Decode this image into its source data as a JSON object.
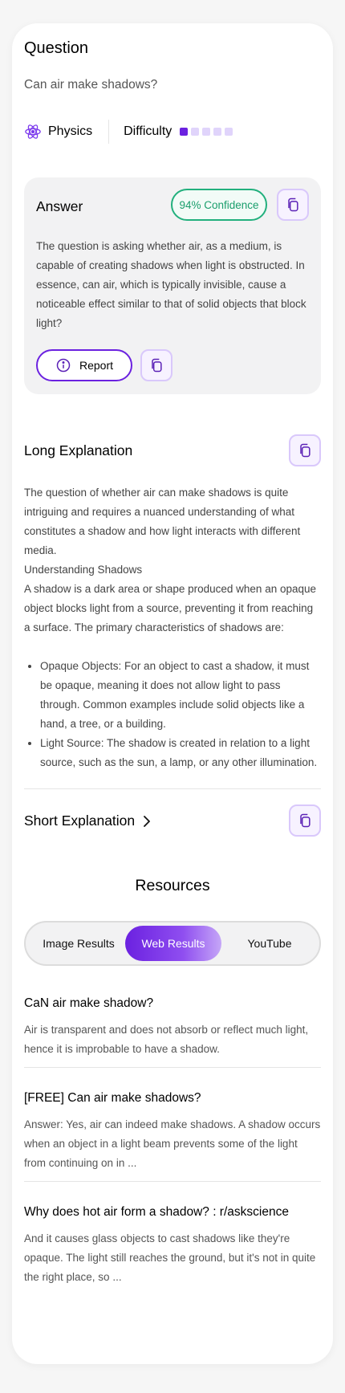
{
  "question": {
    "title": "Question",
    "text": "Can air make shadows?",
    "subject": "Physics",
    "difficulty_label": "Difficulty",
    "difficulty_level": 1,
    "difficulty_max": 5
  },
  "answer": {
    "title": "Answer",
    "confidence": "94% Confidence",
    "text": "The question is asking whether air, as a medium, is capable of creating shadows when light is obstructed. In essence, can air, which is typically invisible, cause a noticeable effect similar to that of solid objects that block light?",
    "report_label": "Report"
  },
  "long_explanation": {
    "title": "Long Explanation",
    "paragraphs": [
      "The question of whether air can make shadows is quite intriguing and requires a nuanced understanding of what constitutes a shadow and how light interacts with different media.",
      "Understanding Shadows",
      "A shadow is a dark area or shape produced when an opaque object blocks light from a source, preventing it from reaching a surface. The primary characteristics of shadows are:"
    ],
    "bullets": [
      "Opaque Objects: For an object to cast a shadow, it must be opaque, meaning it does not allow light to pass through. Common examples include solid objects like a hand, a tree, or a building.",
      "Light Source: The shadow is created in relation to a light source, such as the sun, a lamp, or any other illumination."
    ]
  },
  "short_explanation": {
    "title": "Short Explanation"
  },
  "resources": {
    "title": "Resources",
    "tabs": [
      "Image Results",
      "Web Results",
      "YouTube"
    ],
    "active_tab": 1,
    "items": [
      {
        "title": "CaN air make shadow?",
        "snippet": "Air is transparent and does not absorb or reflect much light, hence it is improbable to have a shadow."
      },
      {
        "title": "[FREE] Can air make shadows?",
        "snippet": "Answer: Yes, air can indeed make shadows. A shadow occurs when an object in a light beam prevents some of the light from continuing on in ..."
      },
      {
        "title": "Why does hot air form a shadow? : r/askscience",
        "snippet": "And it causes glass objects to cast shadows like they're opaque. The light still reaches the ground, but it's not in quite the right place, so ..."
      }
    ]
  },
  "colors": {
    "accent": "#6b21e0",
    "confidence": "#22b07d",
    "copy_border": "#d9c8fb"
  },
  "icons": {
    "subject": "atom-icon",
    "copy": "copy-icon",
    "report": "info-icon",
    "expand": "chevron-right-icon"
  }
}
